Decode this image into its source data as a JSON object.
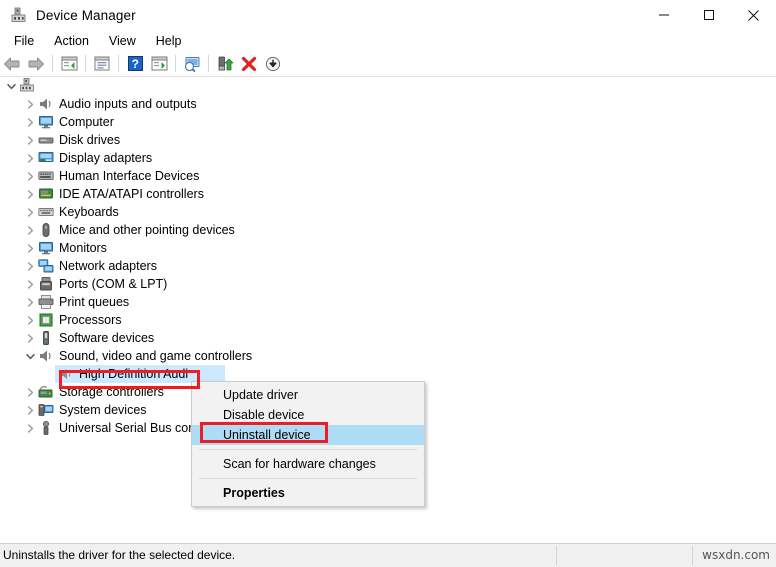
{
  "window": {
    "title": "Device Manager",
    "title_icon": "device-manager-icon",
    "buttons": {
      "minimize": "minimize-icon",
      "maximize": "maximize-icon",
      "close": "close-icon"
    }
  },
  "menubar": {
    "items": [
      "File",
      "Action",
      "View",
      "Help"
    ]
  },
  "toolbar": {
    "items": [
      {
        "name": "back-arrow-icon",
        "type": "icon"
      },
      {
        "name": "forward-arrow-icon",
        "type": "icon"
      },
      {
        "name": "separator",
        "type": "sep"
      },
      {
        "name": "show-hidden-devices-icon",
        "type": "icon"
      },
      {
        "name": "separator",
        "type": "sep"
      },
      {
        "name": "properties-icon",
        "type": "icon"
      },
      {
        "name": "separator",
        "type": "sep"
      },
      {
        "name": "help-icon",
        "type": "icon"
      },
      {
        "name": "view-devices-icon",
        "type": "icon"
      },
      {
        "name": "separator",
        "type": "sep"
      },
      {
        "name": "scan-for-hardware-changes-icon",
        "type": "icon"
      },
      {
        "name": "separator",
        "type": "sep"
      },
      {
        "name": "update-driver-icon",
        "type": "icon"
      },
      {
        "name": "disable-device-icon",
        "type": "icon"
      },
      {
        "name": "uninstall-device-icon",
        "type": "icon"
      }
    ]
  },
  "tree": {
    "root": {
      "label": "",
      "expanded": true,
      "icon": "computer-root-icon"
    },
    "nodes": [
      {
        "label": "Audio inputs and outputs",
        "icon": "speaker-icon",
        "expanded": false
      },
      {
        "label": "Computer",
        "icon": "monitor-icon",
        "expanded": false
      },
      {
        "label": "Disk drives",
        "icon": "disk-drive-icon",
        "expanded": false
      },
      {
        "label": "Display adapters",
        "icon": "display-adapter-icon",
        "expanded": false
      },
      {
        "label": "Human Interface Devices",
        "icon": "hid-icon",
        "expanded": false
      },
      {
        "label": "IDE ATA/ATAPI controllers",
        "icon": "ide-controller-icon",
        "expanded": false
      },
      {
        "label": "Keyboards",
        "icon": "keyboard-icon",
        "expanded": false
      },
      {
        "label": "Mice and other pointing devices",
        "icon": "mouse-icon",
        "expanded": false
      },
      {
        "label": "Monitors",
        "icon": "monitor-icon",
        "expanded": false
      },
      {
        "label": "Network adapters",
        "icon": "network-adapter-icon",
        "expanded": false
      },
      {
        "label": "Ports (COM & LPT)",
        "icon": "port-icon",
        "expanded": false
      },
      {
        "label": "Print queues",
        "icon": "printer-icon",
        "expanded": false
      },
      {
        "label": "Processors",
        "icon": "processor-icon",
        "expanded": false
      },
      {
        "label": "Software devices",
        "icon": "software-device-icon",
        "expanded": false
      },
      {
        "label": "Sound, video and game controllers",
        "icon": "speaker-icon",
        "expanded": true
      },
      {
        "label": "Storage controllers",
        "icon": "storage-controller-icon",
        "expanded": false
      },
      {
        "label": "System devices",
        "icon": "system-device-icon",
        "expanded": false
      },
      {
        "label": "Universal Serial Bus cont",
        "icon": "usb-icon",
        "expanded": false
      }
    ],
    "selected_device": {
      "label": "High Definition Audi",
      "icon": "speaker-icon"
    }
  },
  "context_menu": {
    "items": [
      {
        "label": "Update driver",
        "type": "item",
        "selected": false,
        "bold": false
      },
      {
        "label": "Disable device",
        "type": "item",
        "selected": false,
        "bold": false
      },
      {
        "label": "Uninstall device",
        "type": "item",
        "selected": true,
        "bold": false
      },
      {
        "label": "",
        "type": "separator"
      },
      {
        "label": "Scan for hardware changes",
        "type": "item",
        "selected": false,
        "bold": false
      },
      {
        "label": "",
        "type": "separator"
      },
      {
        "label": "Properties",
        "type": "item",
        "selected": false,
        "bold": true
      }
    ]
  },
  "statusbar": {
    "text": "Uninstalls the driver for the selected device.",
    "watermark": "wsxdn.com"
  },
  "colors": {
    "selection_blue": "#aedcf5",
    "tree_selection_blue": "#cde8ff",
    "annotation_red": "#ee1c25",
    "menu_background": "#f2f2f2",
    "statusbar_background": "#f0f0f0"
  }
}
